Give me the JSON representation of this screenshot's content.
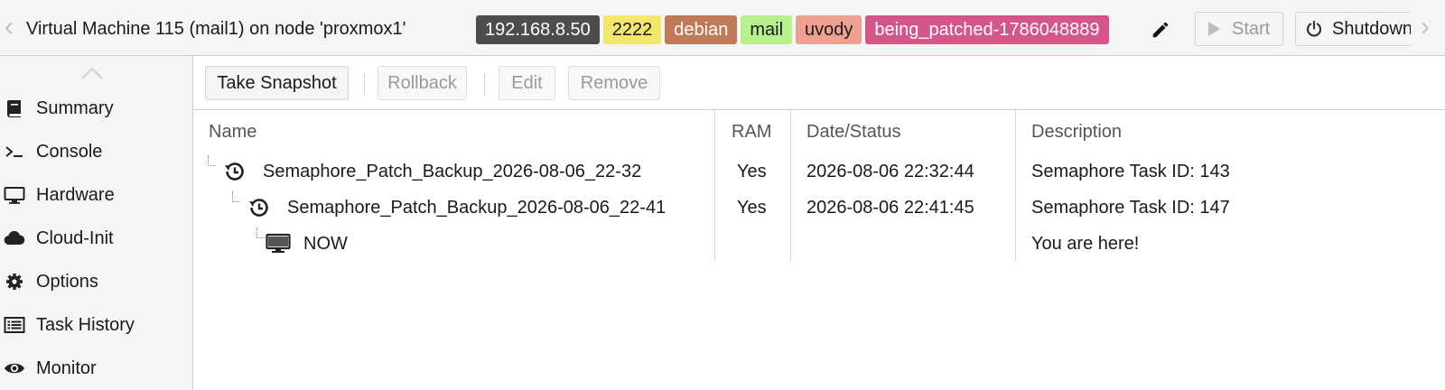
{
  "header": {
    "title": "Virtual Machine 115 (mail1) on node 'proxmox1'",
    "tags": [
      {
        "label": "192.168.8.50",
        "bg": "#4d4d4d",
        "fg": "#ffffff"
      },
      {
        "label": "2222",
        "bg": "#f2e66b",
        "fg": "#1a1a1a"
      },
      {
        "label": "debian",
        "bg": "#c07a58",
        "fg": "#ffffff"
      },
      {
        "label": "mail",
        "bg": "#b8f08c",
        "fg": "#1a1a1a"
      },
      {
        "label": "uvody",
        "bg": "#f0a090",
        "fg": "#1a1a1a"
      },
      {
        "label": "being_patched-1786048889",
        "bg": "#d4558a",
        "fg": "#ffffff"
      }
    ],
    "start_label": "Start",
    "shutdown_label": "Shutdown",
    "icons": {
      "edit": "pencil-icon",
      "start": "play-icon",
      "shutdown": "power-icon",
      "nav_left": "chevron-left-icon",
      "nav_right": "chevron-right-icon"
    }
  },
  "sidebar": {
    "items": [
      {
        "label": "Summary",
        "icon": "book-icon"
      },
      {
        "label": "Console",
        "icon": "terminal-icon"
      },
      {
        "label": "Hardware",
        "icon": "monitor-icon"
      },
      {
        "label": "Cloud-Init",
        "icon": "cloud-icon"
      },
      {
        "label": "Options",
        "icon": "gear-icon"
      },
      {
        "label": "Task History",
        "icon": "list-icon"
      },
      {
        "label": "Monitor",
        "icon": "eye-icon"
      }
    ]
  },
  "toolbar": {
    "take_snapshot": "Take Snapshot",
    "rollback": "Rollback",
    "edit": "Edit",
    "remove": "Remove"
  },
  "grid": {
    "columns": {
      "name": "Name",
      "ram": "RAM",
      "date": "Date/Status",
      "description": "Description"
    },
    "rows": [
      {
        "name": "Semaphore_Patch_Backup_2026-08-06_22-32",
        "ram": "Yes",
        "date": "2026-08-06 22:32:44",
        "description": "Semaphore Task ID: 143",
        "icon": "snapshot-history-icon"
      },
      {
        "name": "Semaphore_Patch_Backup_2026-08-06_22-41",
        "ram": "Yes",
        "date": "2026-08-06 22:41:45",
        "description": "Semaphore Task ID: 147",
        "icon": "snapshot-history-icon"
      },
      {
        "name": "NOW",
        "ram": "",
        "date": "",
        "description": "You are here!",
        "icon": "monitor-icon"
      }
    ]
  }
}
